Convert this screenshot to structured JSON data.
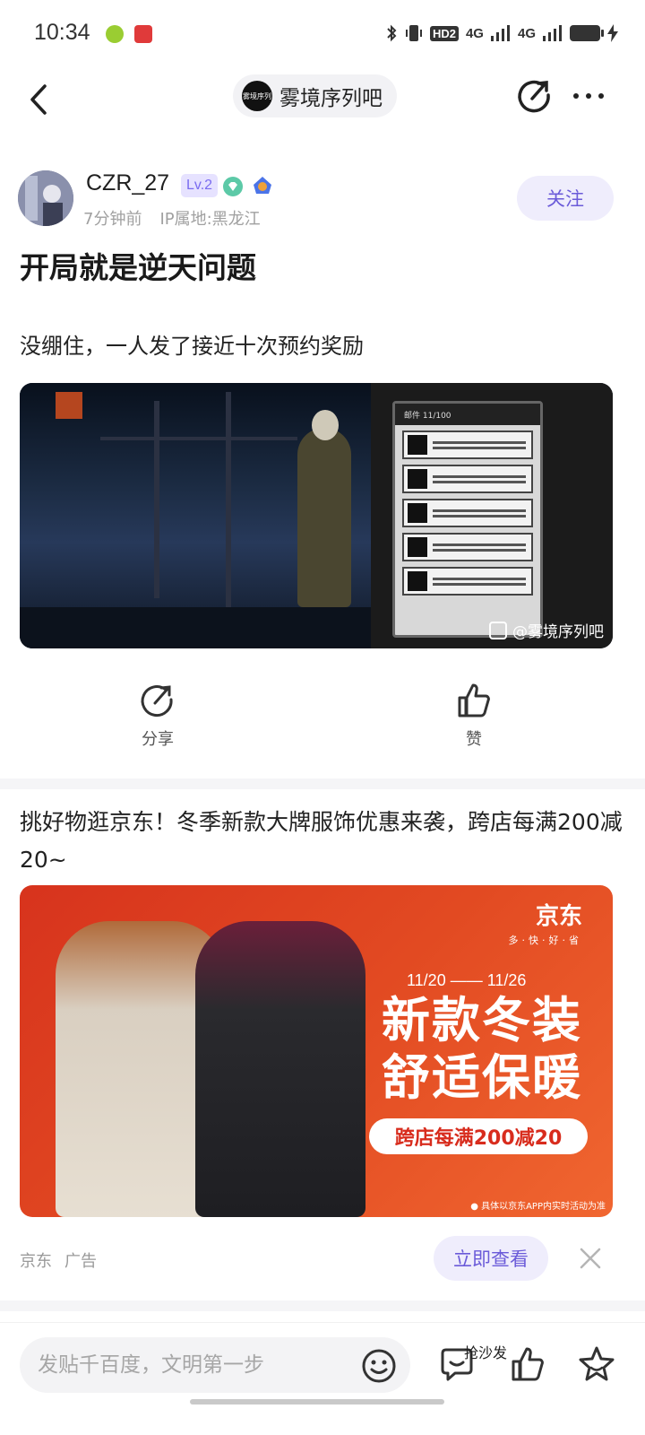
{
  "status_bar": {
    "time": "10:34",
    "network_1": "4G",
    "network_2": "4G",
    "hd_label": "HD2",
    "icons": [
      "bluetooth-icon",
      "vibrate-icon",
      "signal-icon",
      "battery-icon",
      "charging-icon"
    ]
  },
  "nav": {
    "forum_name": "雾境序列吧",
    "forum_avatar_text": "雾境序列",
    "icons": [
      "back-icon",
      "share-icon",
      "more-icon"
    ]
  },
  "post": {
    "author": {
      "username": "CZR_27",
      "level": "Lv.2",
      "time_ago": "7分钟前",
      "location": "IP属地:黑龙江",
      "follow_label": "关注"
    },
    "title": "开局就是逆天问题",
    "body": "没绷住，一人发了接近十次预约奖励",
    "image": {
      "watermark": "@雾境序列吧",
      "mail_header": "邮件  11/100"
    },
    "actions": {
      "share_label": "分享",
      "like_label": "赞"
    }
  },
  "ad": {
    "text": "挑好物逛京东！冬季新款大牌服饰优惠来袭，跨店每满200减20~",
    "banner": {
      "brand": "京东",
      "slogan": "多·快·好·省",
      "date_range": "11/20 —— 11/26",
      "headline_line1": "新款冬装",
      "headline_line2": "舒适保暖",
      "promo": "跨店每满200减20",
      "footnote": "● 具体以京东APP内实时活动为准"
    },
    "source": "京东",
    "ad_label": "广告",
    "cta_label": "立即查看"
  },
  "bottom_bar": {
    "input_placeholder": "发贴千百度，文明第一步",
    "sofa_label": "抢沙发"
  },
  "colors": {
    "accent": "#6b5bd9",
    "accent_bg": "#efedfc",
    "jd_red": "#e24a22"
  }
}
